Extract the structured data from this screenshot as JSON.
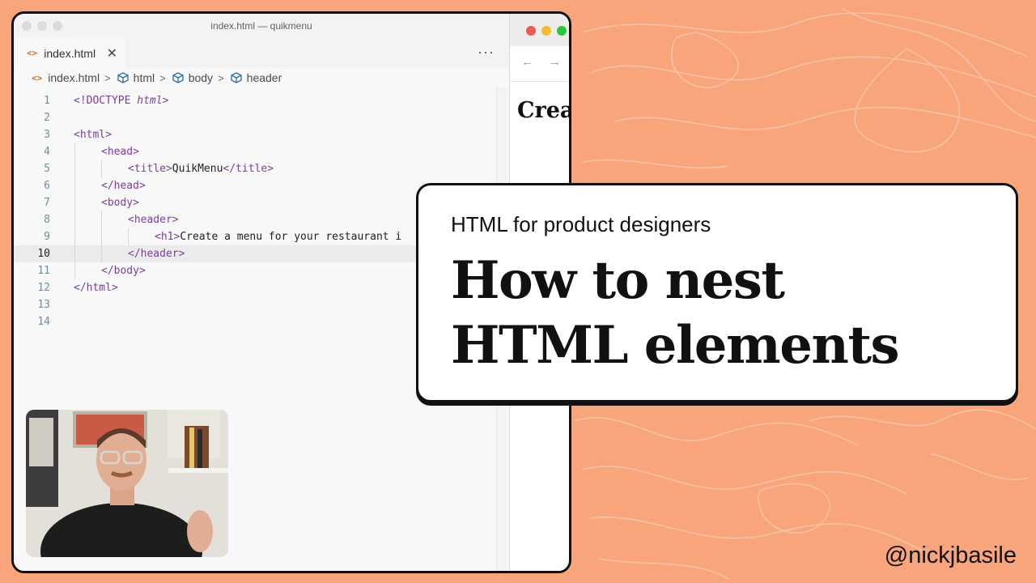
{
  "colors": {
    "background": "#F8A57C",
    "card": "#FFFFFF",
    "tag_purple": "#7A3E9D",
    "file_icon_orange": "#C2702C"
  },
  "editor": {
    "window_title": "index.html — quikmenu",
    "tab": {
      "icon": "html-file-icon",
      "label": "index.html",
      "close_icon": "close-icon"
    },
    "more_icon": "ellipsis-icon",
    "breadcrumb": [
      {
        "icon": "html-file-icon",
        "label": "index.html"
      },
      {
        "icon": "element-cube-icon",
        "label": "html"
      },
      {
        "icon": "element-cube-icon",
        "label": "body"
      },
      {
        "icon": "element-cube-icon",
        "label": "header"
      }
    ],
    "current_line": 10,
    "lines": [
      {
        "num": "1",
        "text": "<!DOCTYPE html>"
      },
      {
        "num": "2",
        "text": ""
      },
      {
        "num": "3",
        "text": "<html>"
      },
      {
        "num": "4",
        "text": "<head>"
      },
      {
        "num": "5",
        "text": "<title>QuikMenu</title>"
      },
      {
        "num": "6",
        "text": "</head>"
      },
      {
        "num": "7",
        "text": "<body>"
      },
      {
        "num": "8",
        "text": "<header>"
      },
      {
        "num": "9",
        "text": "<h1>Create a menu for your restaurant i"
      },
      {
        "num": "10",
        "text": "</header>"
      },
      {
        "num": "11",
        "text": "</body>"
      },
      {
        "num": "12",
        "text": "</html>"
      },
      {
        "num": "13",
        "text": ""
      },
      {
        "num": "14",
        "text": ""
      }
    ]
  },
  "browser": {
    "back_icon": "back-arrow-icon",
    "forward_icon": "forward-arrow-icon",
    "heading_visible": "Creat"
  },
  "card": {
    "subtitle": "HTML for product designers",
    "title_line1": "How to nest",
    "title_line2": "HTML elements"
  },
  "handle": "@nickjbasile"
}
